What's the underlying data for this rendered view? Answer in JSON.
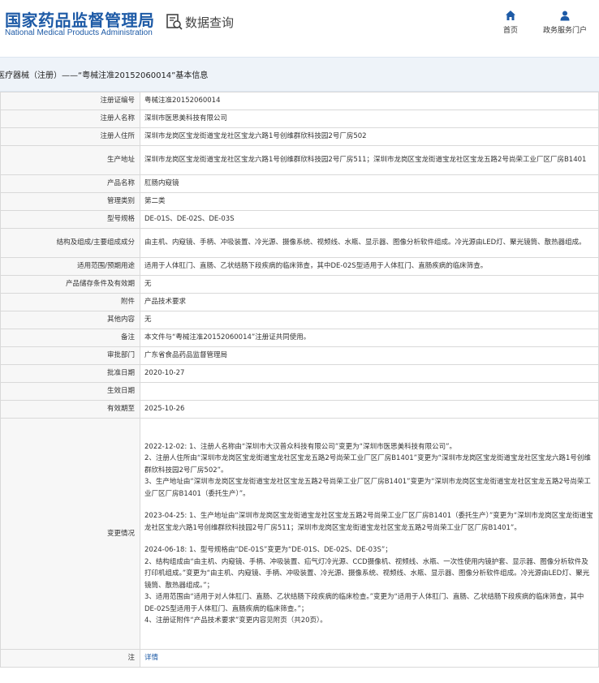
{
  "header": {
    "logo_cn": "国家药品监督管理局",
    "logo_en": "National Medical Products Administration",
    "query_label": "数据查询",
    "nav": {
      "home": "首页",
      "portal": "政务服务门户"
    }
  },
  "breadcrumb": "医疗器械（注册）——“粤械注准20152060014”基本信息",
  "rows": [
    {
      "label": "注册证编号",
      "value": "粤械注准20152060014"
    },
    {
      "label": "注册人名称",
      "value": "深圳市医思美科技有限公司"
    },
    {
      "label": "注册人住所",
      "value": "深圳市龙岗区宝龙街道宝龙社区宝龙六路1号创维群欣科技园2号厂房502"
    },
    {
      "label": "生产地址",
      "value": "深圳市龙岗区宝龙街道宝龙社区宝龙六路1号创维群欣科技园2号厂房511；深圳市龙岗区宝龙街道宝龙社区宝龙五路2号尚荣工业厂区厂房B1401"
    },
    {
      "label": "产品名称",
      "value": "肛肠内窥镜"
    },
    {
      "label": "管理类别",
      "value": "第二类"
    },
    {
      "label": "型号规格",
      "value": "DE-01S、DE-02S、DE-03S"
    },
    {
      "label": "结构及组成/主要组成成分",
      "value": "由主机、内窥镜、手柄、冲吸装置、冷光源、摄像系统、视频线、水瓶、显示器、图像分析软件组成。冷光源由LED灯、聚光镜筒、散热器组成。"
    },
    {
      "label": "适用范围/预期用途",
      "value": "适用于人体肛门、直肠、乙状结肠下段疾病的临床筛查，其中DE-02S型适用于人体肛门、直肠疾病的临床筛查。"
    },
    {
      "label": "产品储存条件及有效期",
      "value": "无"
    },
    {
      "label": "附件",
      "value": "产品技术要求"
    },
    {
      "label": "其他内容",
      "value": "无"
    },
    {
      "label": "备注",
      "value": "本文件与“粤械注准20152060014”注册证共同使用。"
    },
    {
      "label": "审批部门",
      "value": "广东省食品药品监督管理局"
    },
    {
      "label": "批准日期",
      "value": "2020-10-27"
    },
    {
      "label": "生效日期",
      "value": ""
    },
    {
      "label": "有效期至",
      "value": "2025-10-26"
    }
  ],
  "changes": {
    "label": "变更情况",
    "blocks": [
      "2022-12-02: 1、注册人名称由“深圳市大汉普众科技有限公司”变更为“深圳市医思美科技有限公司”。\n2、注册人住所由“深圳市龙岗区宝龙街道宝龙社区宝龙五路2号尚荣工业厂区厂房B1401”变更为“深圳市龙岗区宝龙街道宝龙社区宝龙六路1号创维群欣科技园2号厂房502”。\n3、生产地址由“深圳市龙岗区宝龙街道宝龙社区宝龙五路2号尚荣工业厂区厂房B1401”变更为“深圳市龙岗区宝龙街道宝龙社区宝龙五路2号尚荣工业厂区厂房B1401（委托生产）”。",
      "2023-04-25: 1、生产地址由“深圳市龙岗区宝龙街道宝龙社区宝龙五路2号尚荣工业厂区厂房B1401（委托生产）”变更为“深圳市龙岗区宝龙街道宝龙社区宝龙六路1号创维群欣科技园2号厂房511；深圳市龙岗区宝龙街道宝龙社区宝龙五路2号尚荣工业厂区厂房B1401”。",
      "2024-06-18: 1、型号规格由“DE-01S”变更为“DE-01S、DE-02S、DE-03S”；\n2、结构组成由“由主机、内窥镜、手柄、冲吸装置、疝气灯冷光源、CCD摄像机、视频线、水瓶、一次性使用内镜护套、显示器、图像分析软件及打印机组成。”变更为“由主机、内窥镜、手柄、冲吸装置、冷光源、摄像系统、视频线、水瓶、显示器、图像分析软件组成。冷光源由LED灯、聚光镜筒、散热器组成。”；\n3、适用范围由“适用于对人体肛门、直肠、乙状结肠下段疾病的临床检查。”变更为“适用于人体肛门、直肠、乙状结肠下段疾病的临床筛查，其中DE-02S型适用于人体肛门、直肠疾病的临床筛查。”；\n4、注册证附件“产品技术要求”变更内容见附页（共20页）。"
    ]
  },
  "note": {
    "label": "注",
    "value": "详情"
  },
  "colors": {
    "brand": "#1d5aa6",
    "label_bg": "#f7f7f7",
    "border": "#d9d9d9"
  },
  "icons": [
    "search-doc-icon",
    "home-icon",
    "user-icon"
  ]
}
